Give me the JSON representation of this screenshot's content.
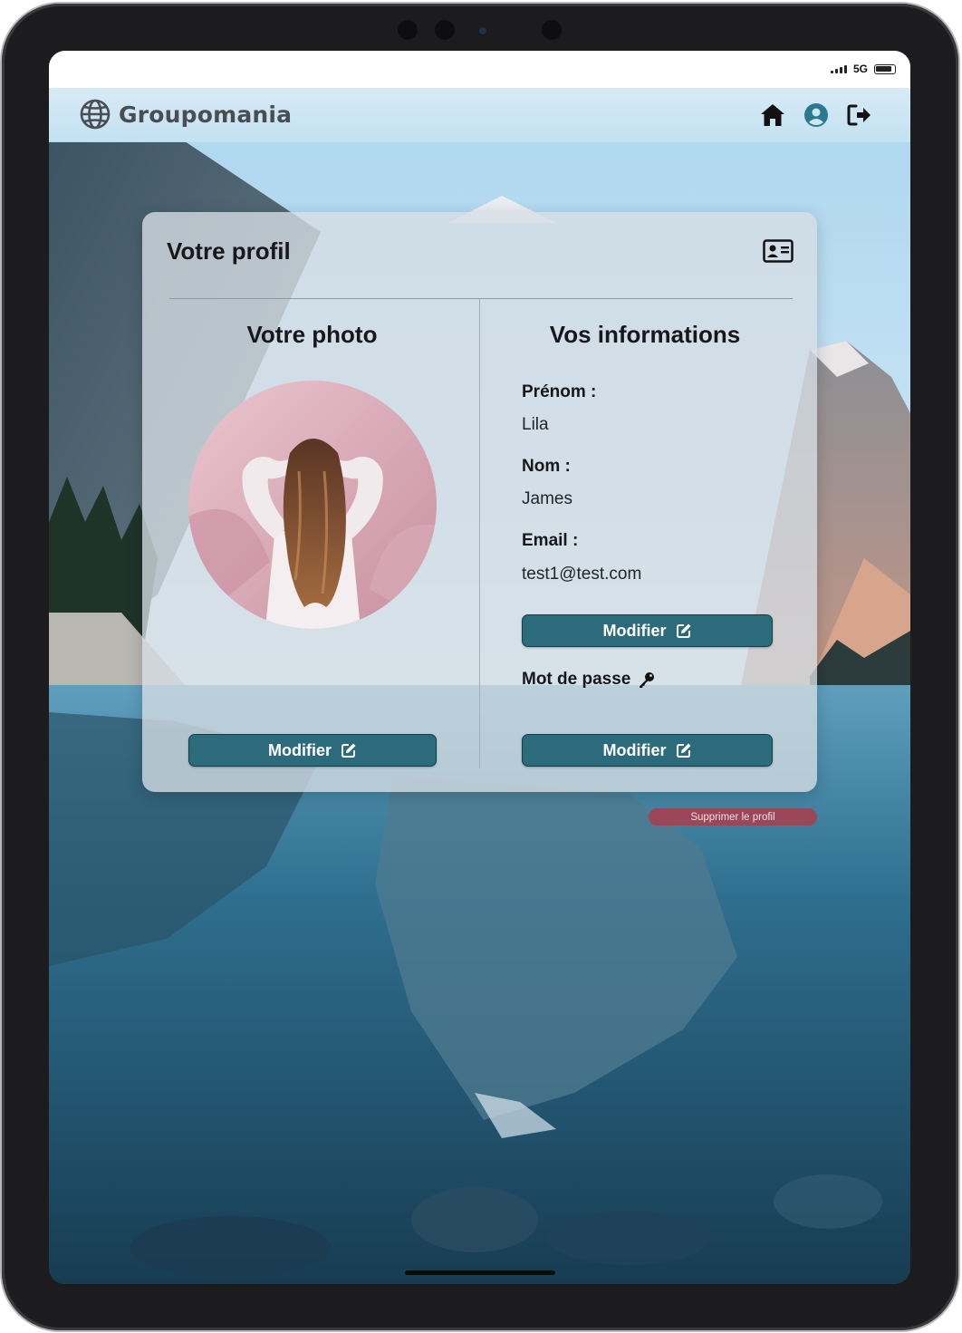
{
  "status_bar": {
    "network": "5G"
  },
  "header": {
    "brand": "Groupomania",
    "icons": [
      "globe-icon",
      "home-icon",
      "user-circle-icon",
      "logout-icon"
    ]
  },
  "profile": {
    "title": "Votre profil",
    "photo_section": {
      "title": "Votre photo",
      "button_label": "Modifier"
    },
    "info_section": {
      "title": "Vos informations",
      "fields": [
        {
          "label": "Prénom :",
          "value": "Lila"
        },
        {
          "label": "Nom :",
          "value": "James"
        },
        {
          "label": "Email :",
          "value": "test1@test.com"
        }
      ],
      "edit_button_label": "Modifier",
      "password_label": "Mot de passe",
      "password_button_label": "Modifier"
    },
    "delete_label": "Supprimer le profil"
  },
  "colors": {
    "button": "#2b6b7c",
    "delete": "#ac3c4c",
    "brand_text": "#4a4d52"
  }
}
